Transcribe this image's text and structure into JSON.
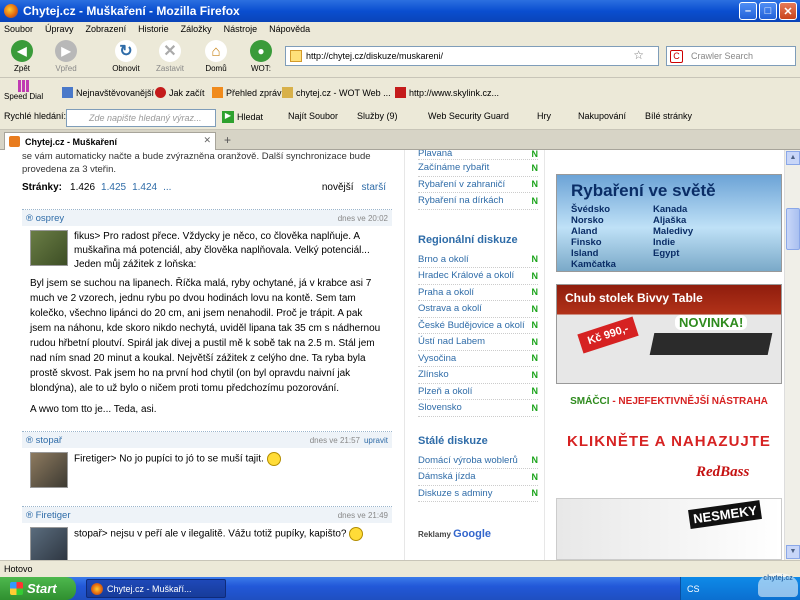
{
  "window": {
    "title": "Chytej.cz - Muškaření - Mozilla Firefox"
  },
  "menu": [
    "Soubor",
    "Úpravy",
    "Zobrazení",
    "Historie",
    "Záložky",
    "Nástroje",
    "Nápověda"
  ],
  "nav": {
    "back": "Zpět",
    "forward": "Vpřed",
    "reload": "Obnovit",
    "stop": "Zastavit",
    "home": "Domů",
    "wot": "WOT:"
  },
  "url": "http://chytej.cz/diskuze/muskareni/",
  "search_placeholder": "Crawler Search",
  "bookmarks": {
    "speed_dial": "Speed Dial",
    "items": [
      "Nejnavštěvovanější",
      "Jak začít",
      "Přehled zpráv",
      "chytej.cz - WOT Web ...",
      "http://www.skylink.cz..."
    ]
  },
  "fastbar": {
    "label": "Rychlé hledání:",
    "placeholder": "Zde napište hledaný výraz...",
    "search": "Hledat",
    "find": "Najít Soubor",
    "services": "Služby (9)",
    "wsg": "Web Security Guard",
    "games": "Hry",
    "shopping": "Nakupování",
    "white": "Bílé stránky"
  },
  "tab": {
    "title": "Chytej.cz - Muškaření"
  },
  "page": {
    "intro": "se vám automaticky načte a bude zvýrazněna oranžově. Další synchronizace bude provedena za 3 vteřin.",
    "pager": {
      "label": "Stránky:",
      "current": "1.426",
      "p2": "1.425",
      "p3": "1.424",
      "dots": "...",
      "newer": "novější",
      "older": "starší"
    },
    "posts": [
      {
        "author": "osprey",
        "date": "dnes ve 20:02",
        "short": "fikus> Pro radost přece. Vždycky je něco, co člověka naplňuje. A muškařina má potenciál, aby člověka naplňovala. Velký potenciál... Jeden můj zážitek z loňska:",
        "full": "Byl jsem se suchou na lipanech. Říčka malá, ryby ochytané, já v krabce asi 7 much ve 2 vzorech, jednu rybu po dvou hodinách lovu na kontě. Sem tam kolečko, všechno lipánci do 20 cm, ani jsem nenahodil. Proč je trápit. A pak jsem na náhonu, kde skoro nikdo nechytá, uviděl lipana tak 35 cm s nádhernou rudou hřbetní ploutví. Spirál jak divej a pustil mě k sobě tak na 2.5 m. Stál jem nad ním snad 20 minut a koukal. Největší zážitek z celýho dne. Ta ryba byla prostě skvost. Pak jsem ho na první hod chytil (on byl opravdu naivní jak blondýna), ale to už bylo o ničem proti tomu předchozímu pozorování.",
        "end": "A wwo tom tto je... Teda, asi."
      },
      {
        "author": "stopař",
        "date": "dnes ve 21:57",
        "edit": "upravit",
        "short": "Firetiger> No jo pupíci to jó to se muší tajit."
      },
      {
        "author": "Firetiger",
        "date": "dnes ve 21:49",
        "short": "stopař> nejsu v peří ale v ilegalitě. Vážu totiž pupíky, kapišto?"
      }
    ]
  },
  "middle": {
    "top": [
      "Plavaná",
      "Začínáme rybařit",
      "Rybaření v zahraničí",
      "Rybaření na dírkách"
    ],
    "regional_title": "Regionální diskuze",
    "regional": [
      "Brno a okolí",
      "Hradec Králové a okolí",
      "Praha a okolí",
      "Ostrava a okolí",
      "České Budějovice a okolí",
      "Ústí nad Labem",
      "Vysočina",
      "Zlínsko",
      "Plzeň a okolí",
      "Slovensko"
    ],
    "permanent_title": "Stálé diskuze",
    "permanent": [
      "Domácí výroba woblerů",
      "Dámská jízda",
      "Diskuze s adminy"
    ],
    "badge": "N",
    "ads_label": "Reklamy",
    "ads_brand": "Google"
  },
  "ads": {
    "a1_title": "Rybaření ve světě",
    "a1_left": "Švédsko\nNorsko\nAland\nFinsko\nIsland\nKamčatka",
    "a1_right": "Kanada\nAljaška\nMaledivy\nIndie\nEgypt",
    "a2_title": "Chub stolek Bivvy Table",
    "a2_price": "Kč 990,-",
    "a2_new": "NOVINKA!",
    "a3_brand": "SMÁČCI",
    "a3_rest": " - NEJEFEKTIVNĚJŠÍ NÁSTRAHA",
    "a4": "KLIKNĚTE A NAHAZUJTE",
    "a5": "RedBass",
    "a6": "NESMEKY"
  },
  "status": "Hotovo",
  "taskbar": {
    "start": "Start",
    "item": "Chytej.cz - Muškaří...",
    "lang": "CS"
  }
}
